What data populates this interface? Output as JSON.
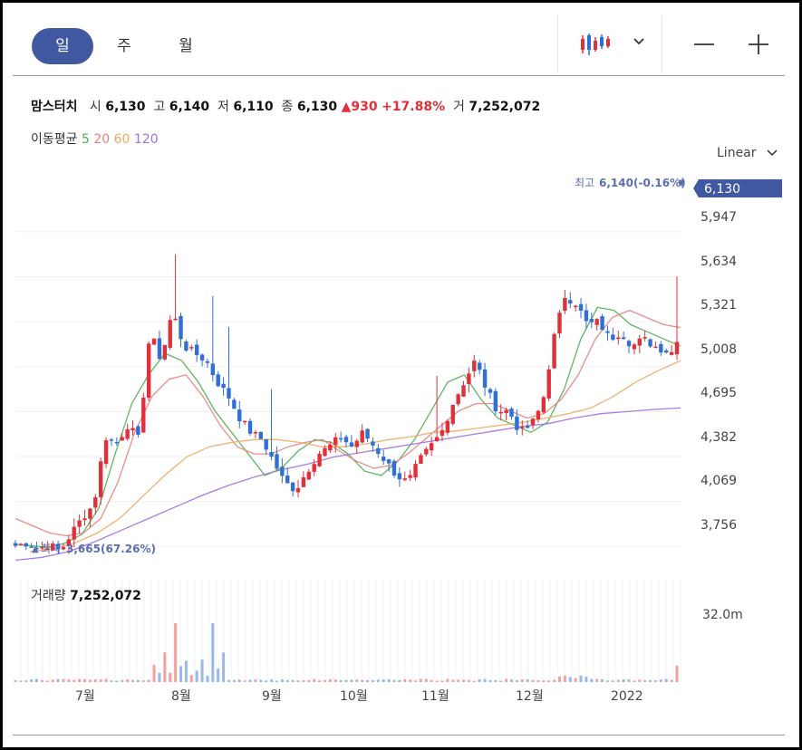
{
  "tabs": [
    {
      "label": "일"
    },
    {
      "label": "주"
    },
    {
      "label": "월"
    }
  ],
  "stock": {
    "name": "맘스터치",
    "open_label": "시",
    "open": "6,130",
    "high_label": "고",
    "high": "6,140",
    "low_label": "저",
    "low": "6,110",
    "close_label": "종",
    "close": "6,130",
    "change": "▲930",
    "change_pct": "+17.88%",
    "volume_label": "거",
    "volume": "7,252,072"
  },
  "ma": {
    "label": "이동평균",
    "p5": "5",
    "p20": "20",
    "p60": "60",
    "p120": "120"
  },
  "colors": {
    "ma5": "#4caf50",
    "ma20": "#e88080",
    "ma60": "#f0a860",
    "ma120": "#a070e0",
    "up": "#e0303a",
    "down": "#2f6fd6",
    "accent": "#3f58a0"
  },
  "scale_label": "Linear",
  "icons": [
    "candlestick-chart-icon",
    "chevron-down-icon",
    "minus-icon",
    "plus-icon"
  ],
  "price_axis": {
    "ticks": [
      "5,947",
      "5,634",
      "5,321",
      "5,008",
      "4,695",
      "4,382",
      "4,069",
      "3,756"
    ]
  },
  "current_price_tag": "6,130",
  "high_marker": {
    "label": "최고",
    "value": "6,140",
    "pct": "(-0.16%)"
  },
  "low_marker": {
    "label": "최저",
    "value": "3,665",
    "pct": "(67.26%)"
  },
  "volume_panel": {
    "label": "거래량",
    "value": "7,252,072",
    "axis_tick": "32.0m"
  },
  "x_axis": [
    "7월",
    "8월",
    "9월",
    "10월",
    "11월",
    "12월",
    "2022"
  ],
  "chart_data": {
    "type": "candlestick",
    "x_labels": [
      "7월",
      "8월",
      "9월",
      "10월",
      "11월",
      "12월",
      "2022"
    ],
    "ylim": [
      3600,
      6280
    ],
    "y_ticks": [
      3756,
      4069,
      4382,
      4695,
      5008,
      5321,
      5634,
      5947
    ],
    "scale": "linear",
    "grid": true,
    "anchors": [
      3760,
      3780,
      3740,
      3770,
      3720,
      3850,
      3960,
      4050,
      4520,
      4470,
      4600,
      4500,
      5250,
      5050,
      5400,
      5150,
      5100,
      5050,
      4900,
      4800,
      4650,
      4550,
      4500,
      4350,
      4200,
      4150,
      4280,
      4400,
      4450,
      4520,
      4450,
      4550,
      4450,
      4350,
      4250,
      4200,
      4350,
      4450,
      4550,
      4750,
      4900,
      5050,
      4850,
      4700,
      4700,
      4550,
      4600,
      4750,
      5200,
      5500,
      5450,
      5300,
      5320,
      5200,
      5250,
      5150,
      5200,
      5150,
      5120,
      5100
    ],
    "moving_averages": [
      {
        "name": "5",
        "values": [
          3770,
          3760,
          3750,
          3780,
          3840,
          4020,
          4400,
          4750,
          4950,
          5100,
          5050,
          4900,
          4700,
          4550,
          4400,
          4250,
          4300,
          4420,
          4500,
          4480,
          4400,
          4280,
          4250,
          4350,
          4500,
          4700,
          4900,
          4950,
          4780,
          4650,
          4600,
          4550,
          4620,
          4850,
          5200,
          5420,
          5400,
          5300,
          5250,
          5200,
          5150
        ]
      },
      {
        "name": "20",
        "values": [
          3950,
          3900,
          3850,
          3830,
          3850,
          3950,
          4200,
          4550,
          4800,
          4920,
          4950,
          4800,
          4600,
          4450,
          4400,
          4400,
          4450,
          4480,
          4500,
          4420,
          4350,
          4300,
          4320,
          4400,
          4500,
          4600,
          4700,
          4750,
          4750,
          4700,
          4650,
          4680,
          4780,
          4950,
          5200,
          5350,
          5400,
          5350,
          5300,
          5280
        ]
      },
      {
        "name": "60",
        "values": [
          3720,
          3740,
          3780,
          3850,
          3950,
          4100,
          4250,
          4380,
          4450,
          4480,
          4500,
          4500,
          4480,
          4450,
          4450,
          4470,
          4500,
          4520,
          4550,
          4560,
          4580,
          4600,
          4620,
          4650,
          4680,
          4720,
          4800,
          4900,
          4980,
          5050
        ]
      },
      {
        "name": "120",
        "values": [
          3660,
          3680,
          3720,
          3790,
          3870,
          3950,
          4030,
          4110,
          4180,
          4240,
          4290,
          4330,
          4380,
          4410,
          4440,
          4470,
          4500,
          4530,
          4560,
          4590,
          4610,
          4650,
          4680,
          4695,
          4710,
          4720
        ]
      }
    ],
    "volume_ylim": [
      0,
      36000000
    ]
  }
}
